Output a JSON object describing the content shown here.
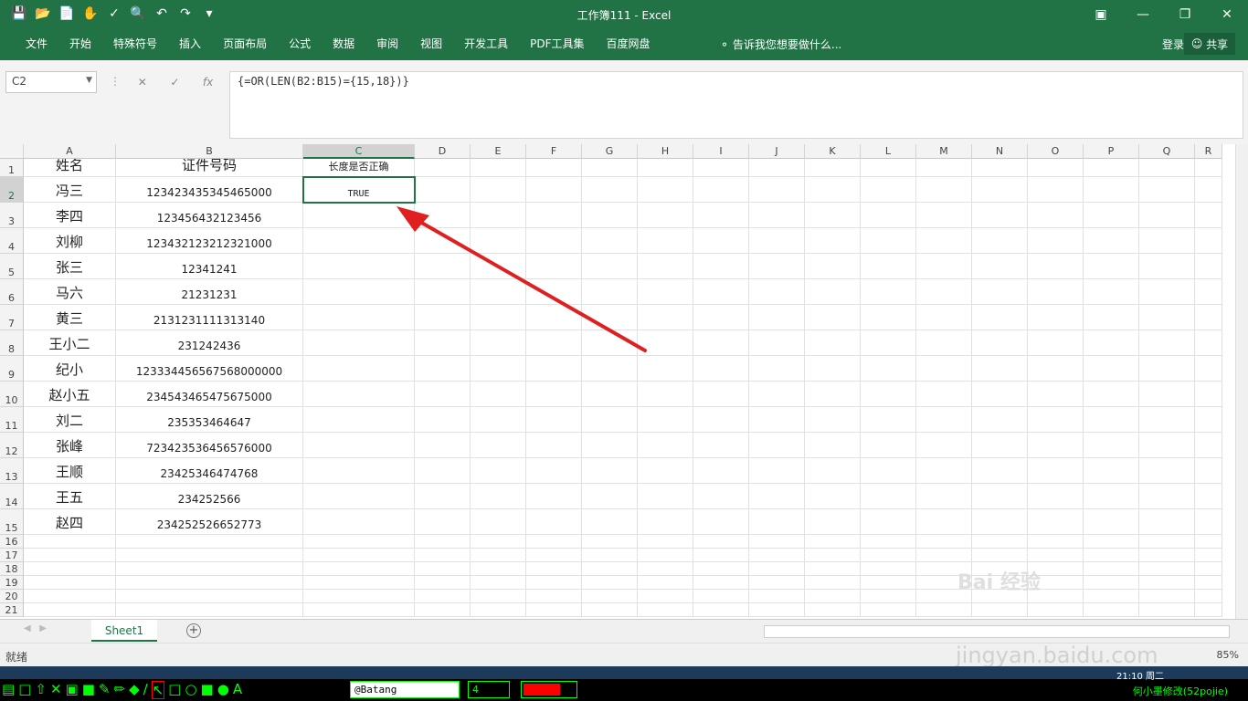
{
  "window": {
    "title": "工作簿111 - Excel"
  },
  "qat_icons": [
    "save-icon",
    "open-icon",
    "new-icon",
    "touch-icon",
    "spellcheck-icon",
    "print-preview-icon",
    "undo-icon",
    "redo-icon",
    "customize-icon"
  ],
  "ribbon": {
    "tabs": [
      "文件",
      "开始",
      "特殊符号",
      "插入",
      "页面布局",
      "公式",
      "数据",
      "审阅",
      "视图",
      "开发工具",
      "PDF工具集",
      "百度网盘"
    ],
    "tell_me": "告诉我您想要做什么...",
    "login": "登录",
    "share": "共享"
  },
  "formula_bar": {
    "name_box": "C2",
    "formula": "{=OR(LEN(B2:B15)={15,18})}",
    "fx": "fx"
  },
  "columns": [
    "A",
    "B",
    "C",
    "D",
    "E",
    "F",
    "G",
    "H",
    "I",
    "J",
    "K",
    "L",
    "M",
    "N",
    "O",
    "P",
    "Q",
    "R"
  ],
  "rows": [
    {
      "n": "1",
      "a": "姓名",
      "b": "证件号码",
      "c": "长度是否正确"
    },
    {
      "n": "2",
      "a": "冯三",
      "b": "123423435345465000",
      "c": "TRUE"
    },
    {
      "n": "3",
      "a": "李四",
      "b": "123456432123456",
      "c": ""
    },
    {
      "n": "4",
      "a": "刘柳",
      "b": "123432123212321000",
      "c": ""
    },
    {
      "n": "5",
      "a": "张三",
      "b": "12341241",
      "c": ""
    },
    {
      "n": "6",
      "a": "马六",
      "b": "21231231",
      "c": ""
    },
    {
      "n": "7",
      "a": "黄三",
      "b": "2131231111313140",
      "c": ""
    },
    {
      "n": "8",
      "a": "王小二",
      "b": "231242436",
      "c": ""
    },
    {
      "n": "9",
      "a": "纪小",
      "b": "123334456567568000000",
      "c": ""
    },
    {
      "n": "10",
      "a": "赵小五",
      "b": "234543465475675000",
      "c": ""
    },
    {
      "n": "11",
      "a": "刘二",
      "b": "235353464647",
      "c": ""
    },
    {
      "n": "12",
      "a": "张峰",
      "b": "723423536456576000",
      "c": ""
    },
    {
      "n": "13",
      "a": "王顺",
      "b": "23425346474768",
      "c": ""
    },
    {
      "n": "14",
      "a": "王五",
      "b": "234252566",
      "c": ""
    },
    {
      "n": "15",
      "a": "赵四",
      "b": "234252526652773",
      "c": ""
    },
    {
      "n": "16",
      "a": "",
      "b": "",
      "c": ""
    },
    {
      "n": "17",
      "a": "",
      "b": "",
      "c": ""
    },
    {
      "n": "18",
      "a": "",
      "b": "",
      "c": ""
    },
    {
      "n": "19",
      "a": "",
      "b": "",
      "c": ""
    },
    {
      "n": "20",
      "a": "",
      "b": "",
      "c": ""
    },
    {
      "n": "21",
      "a": "",
      "b": "",
      "c": ""
    }
  ],
  "sheet_tab": "Sheet1",
  "status": {
    "ready": "就绪",
    "zoom": "85%"
  },
  "overlay": {
    "watermark": "Bai 经验",
    "watermark_url": "jingyan.baidu.com",
    "arrow_color": "#e02020"
  },
  "bottom_toolbar": {
    "font": "@Batang",
    "size": "4",
    "color": "#ff0000",
    "credit": "何小墨修改(52pojie)",
    "clock": "21:10 周二"
  }
}
